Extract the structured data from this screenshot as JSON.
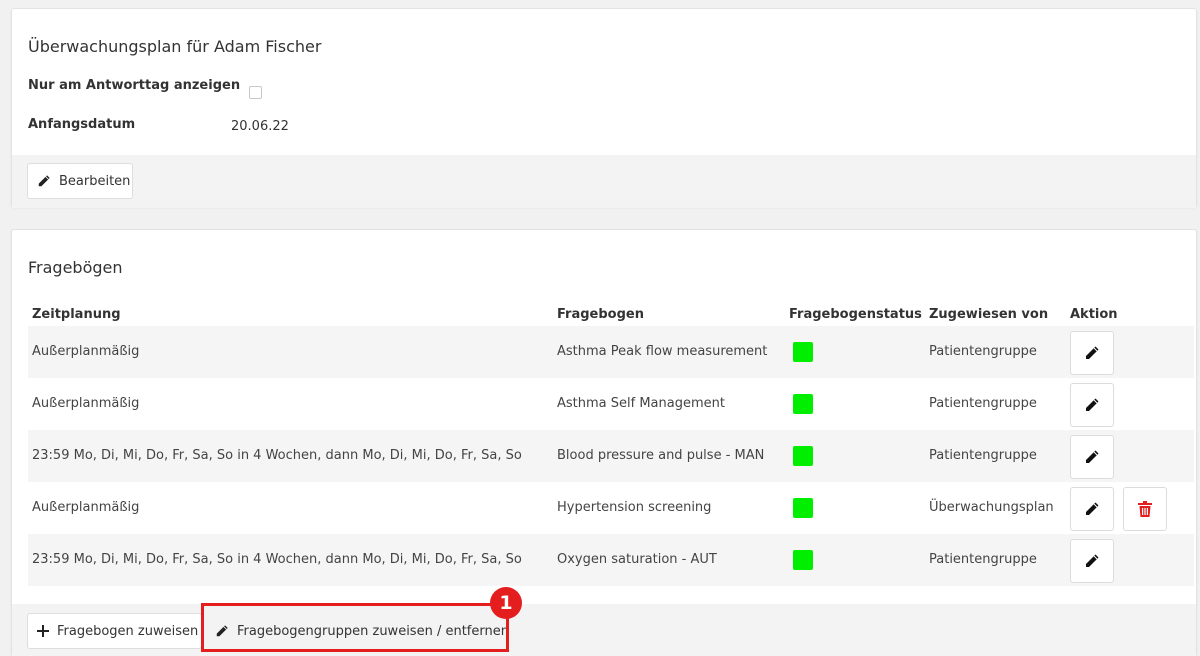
{
  "plan": {
    "title": "Überwachungsplan für Adam Fischer",
    "only_on_response_day_label": "Nur am Antworttag anzeigen",
    "only_on_response_day_checked": false,
    "start_date_label": "Anfangsdatum",
    "start_date_value": "20.06.22",
    "edit_button": "Bearbeiten"
  },
  "questionnaires": {
    "title": "Fragebögen",
    "columns": {
      "schedule": "Zeitplanung",
      "questionnaire": "Fragebogen",
      "status": "Fragebogenstatus",
      "assigned_by": "Zugewiesen von",
      "action": "Aktion"
    },
    "rows": [
      {
        "schedule": "Außerplanmäßig",
        "questionnaire": "Asthma Peak flow measurement",
        "status_color": "#00ef00",
        "assigned_by": "Patientengruppe",
        "deletable": false
      },
      {
        "schedule": "Außerplanmäßig",
        "questionnaire": "Asthma Self Management",
        "status_color": "#00ef00",
        "assigned_by": "Patientengruppe",
        "deletable": false
      },
      {
        "schedule": "23:59 Mo, Di, Mi, Do, Fr, Sa, So in 4 Wochen, dann Mo, Di, Mi, Do, Fr, Sa, So",
        "questionnaire": "Blood pressure and pulse - MAN",
        "status_color": "#00ef00",
        "assigned_by": "Patientengruppe",
        "deletable": false
      },
      {
        "schedule": "Außerplanmäßig",
        "questionnaire": "Hypertension screening",
        "status_color": "#00ef00",
        "assigned_by": "Überwachungsplan",
        "deletable": true
      },
      {
        "schedule": "23:59 Mo, Di, Mi, Do, Fr, Sa, So in 4 Wochen, dann Mo, Di, Mi, Do, Fr, Sa, So",
        "questionnaire": "Oxygen saturation - AUT",
        "status_color": "#00ef00",
        "assigned_by": "Patientengruppe",
        "deletable": false
      }
    ],
    "assign_button": "Fragebogen zuweisen",
    "assign_groups_button": "Fragebogengruppen zuweisen / entfernen"
  },
  "annotation": {
    "badge": "1",
    "color": "#e41e1e"
  },
  "icons": {
    "edit": "pencil-icon",
    "delete": "trash-icon",
    "add": "plus-icon"
  }
}
